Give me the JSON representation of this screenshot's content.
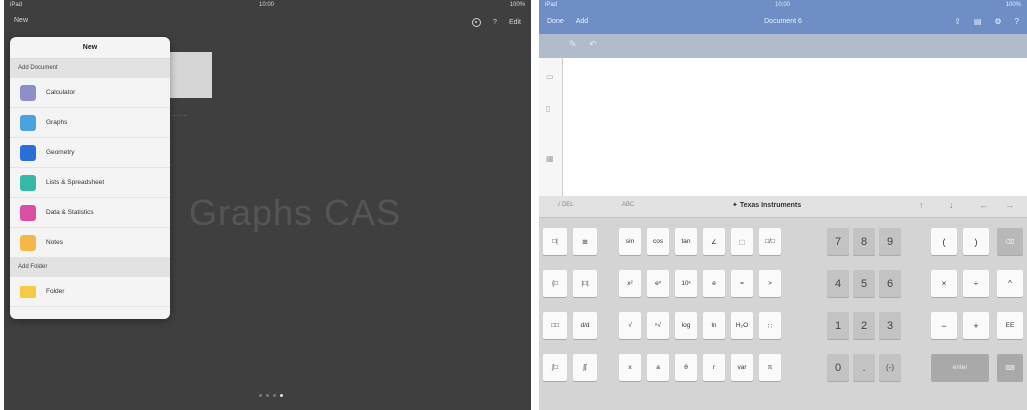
{
  "left": {
    "status": {
      "carrier": "iPad",
      "time": "10:00",
      "battery": "100%"
    },
    "nav": {
      "new_label": "New",
      "help": "?",
      "edit": "Edit"
    },
    "watermark": "Graphs CAS",
    "popover": {
      "title": "New",
      "section_document": "Add Document",
      "items": [
        {
          "label": "Calculator",
          "color": "#8e8ec9"
        },
        {
          "label": "Graphs",
          "color": "#4aa3df"
        },
        {
          "label": "Geometry",
          "color": "#2a6fd6"
        },
        {
          "label": "Lists & Spreadsheet",
          "color": "#36b9a8"
        },
        {
          "label": "Data & Statistics",
          "color": "#d94fa4"
        },
        {
          "label": "Notes",
          "color": "#f5b64a"
        }
      ],
      "section_folder": "Add Folder",
      "folder_item": {
        "label": "Folder",
        "color": "#f7c948"
      }
    }
  },
  "right": {
    "status": {
      "carrier": "iPad",
      "time": "10:00",
      "battery": "100%"
    },
    "nav": {
      "back": "Done",
      "add": "Add",
      "doc_title": "Document 6"
    },
    "keyboard": {
      "tab_left": "√ DEL",
      "tab_abc": "ABC",
      "brand": "Texas Instruments",
      "num_keys": [
        [
          "7",
          "8",
          "9"
        ],
        [
          "4",
          "5",
          "6"
        ],
        [
          "1",
          "2",
          "3"
        ],
        [
          "0",
          ".",
          "(-)"
        ]
      ],
      "func_row1": [
        "sin",
        "cos",
        "tan",
        "∠"
      ],
      "func_row2": [
        "x²",
        "eˣ",
        "10ˣ",
        "e"
      ],
      "func_row3": [
        "√",
        "ⁿ√",
        "log",
        "ln",
        "H₂O"
      ],
      "func_row4": [
        "x",
        "a",
        "θ",
        "r",
        "var",
        "π"
      ],
      "ops": {
        "open_paren": "(",
        "close_paren": ")",
        "times": "×",
        "divide": "÷",
        "caret": "^",
        "minus": "−",
        "plus": "+",
        "ee": "EE",
        "enter": "enter",
        "eq": "=",
        "gt": ">"
      }
    },
    "colors": {
      "accent": "#6f8ec5"
    }
  }
}
